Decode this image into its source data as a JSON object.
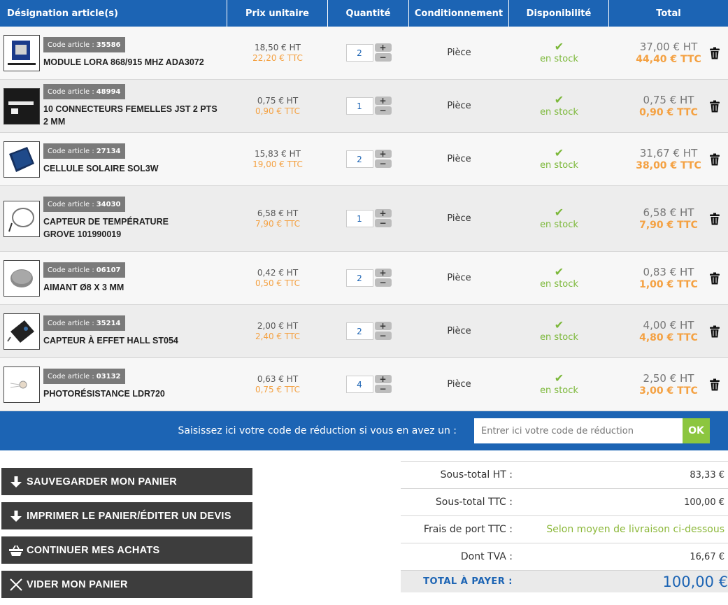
{
  "headers": {
    "designation": "Désignation article(s)",
    "unit_price": "Prix unitaire",
    "quantity": "Quantité",
    "packaging": "Conditionnement",
    "availability": "Disponibilité",
    "total": "Total"
  },
  "code_prefix": "Code article :",
  "items": [
    {
      "code": "35586",
      "name": "MODULE LORA 868/915 MHZ ADA3072",
      "price_ht": "18,50 € HT",
      "price_ttc": "22,20 € TTC",
      "qty": "2",
      "cond": "Pièce",
      "stock": "en stock",
      "total_ht": "37,00 € HT",
      "total_ttc": "44,40 € TTC"
    },
    {
      "code": "48994",
      "name": "10 CONNECTEURS FEMELLES JST 2 PTS 2 MM",
      "price_ht": "0,75 € HT",
      "price_ttc": "0,90 € TTC",
      "qty": "1",
      "cond": "Pièce",
      "stock": "en stock",
      "total_ht": "0,75 € HT",
      "total_ttc": "0,90 € TTC"
    },
    {
      "code": "27134",
      "name": "CELLULE SOLAIRE SOL3W",
      "price_ht": "15,83 € HT",
      "price_ttc": "19,00 € TTC",
      "qty": "2",
      "cond": "Pièce",
      "stock": "en stock",
      "total_ht": "31,67 € HT",
      "total_ttc": "38,00 € TTC"
    },
    {
      "code": "34030",
      "name": "CAPTEUR DE TEMPÉRATURE GROVE 101990019",
      "price_ht": "6,58 € HT",
      "price_ttc": "7,90 € TTC",
      "qty": "1",
      "cond": "Pièce",
      "stock": "en stock",
      "total_ht": "6,58 € HT",
      "total_ttc": "7,90 € TTC"
    },
    {
      "code": "06107",
      "name": "AIMANT Ø8 X 3 MM",
      "price_ht": "0,42 € HT",
      "price_ttc": "0,50 € TTC",
      "qty": "2",
      "cond": "Pièce",
      "stock": "en stock",
      "total_ht": "0,83 € HT",
      "total_ttc": "1,00 € TTC"
    },
    {
      "code": "35214",
      "name": "CAPTEUR À EFFET HALL ST054",
      "price_ht": "2,00 € HT",
      "price_ttc": "2,40 € TTC",
      "qty": "2",
      "cond": "Pièce",
      "stock": "en stock",
      "total_ht": "4,00 € HT",
      "total_ttc": "4,80 € TTC"
    },
    {
      "code": "03132",
      "name": "PHOTORÉSISTANCE LDR720",
      "price_ht": "0,63 € HT",
      "price_ttc": "0,75 € TTC",
      "qty": "4",
      "cond": "Pièce",
      "stock": "en stock",
      "total_ht": "2,50 € HT",
      "total_ttc": "3,00 € TTC"
    }
  ],
  "promo": {
    "label": "Saisissez ici votre code de réduction si vous en avez un :",
    "placeholder": "Entrer ici votre code de réduction",
    "ok": "OK"
  },
  "actions": {
    "save": "SAUVEGARDER MON PANIER",
    "print": "IMPRIMER LE PANIER/ÉDITER UN DEVIS",
    "continue": "CONTINUER MES ACHATS",
    "empty": "VIDER MON PANIER"
  },
  "summary": {
    "subtotal_ht_label": "Sous-total HT :",
    "subtotal_ht": "83,33 €",
    "subtotal_ttc_label": "Sous-total TTC :",
    "subtotal_ttc": "100,00 €",
    "shipping_label": "Frais de port TTC :",
    "shipping": "Selon moyen de livraison ci-dessous",
    "vat_label": "Dont TVA :",
    "vat": "16,67 €",
    "total_label": "TOTAL À PAYER :",
    "total": "100,00 €"
  },
  "colors": {
    "header_blue": "#1c64b4",
    "price_orange": "#f4a142",
    "stock_green": "#7cb83a",
    "button_dark": "#3d3d3d"
  },
  "icons": {
    "stock": "check-icon",
    "remove": "trash-icon",
    "save": "arrow-down-icon",
    "print": "arrow-down-icon",
    "continue": "basket-icon",
    "empty": "close-icon"
  }
}
